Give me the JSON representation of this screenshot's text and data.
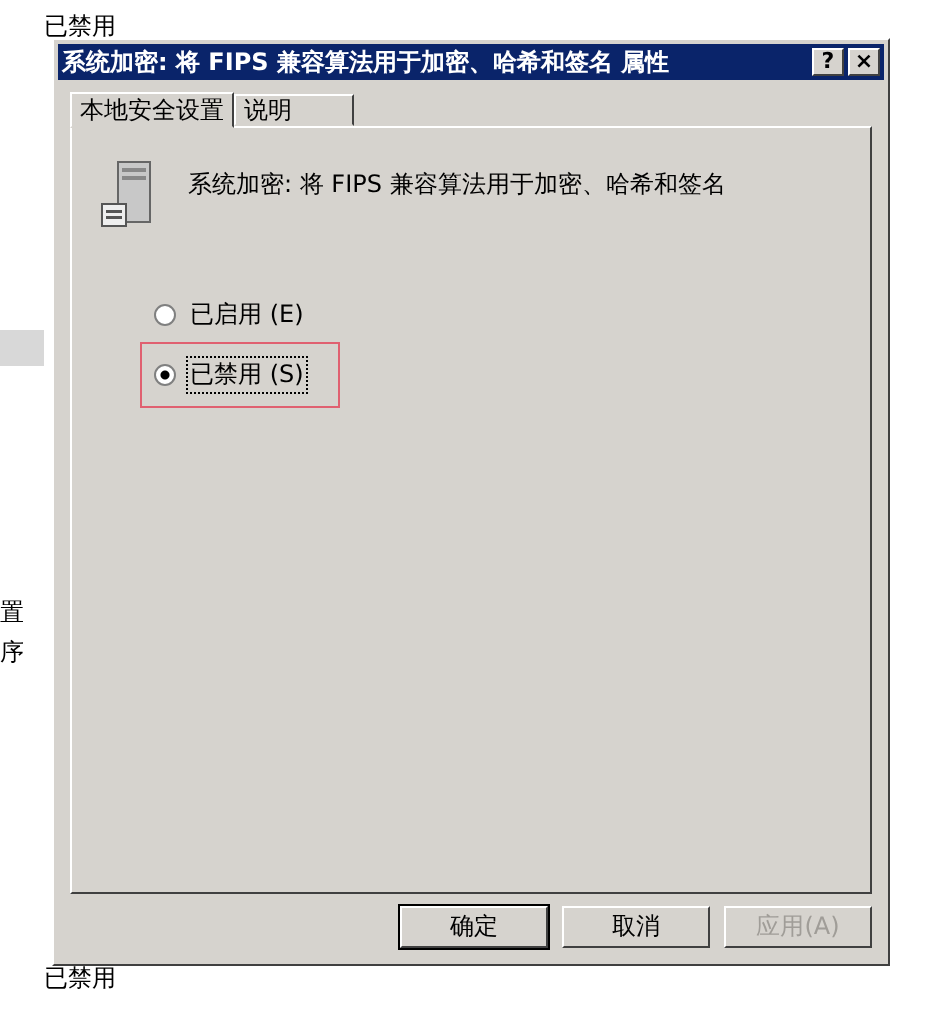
{
  "background_list": {
    "top_items": [
      "已禁用"
    ],
    "side_items": [
      "置",
      "序"
    ],
    "bottom_item": "已禁用"
  },
  "window": {
    "title": "系统加密: 将 FIPS 兼容算法用于加密、哈希和签名 属性",
    "help_button": "?",
    "close_button": "×"
  },
  "tabs": [
    {
      "label": "本地安全设置",
      "selected": true
    },
    {
      "label": "说明",
      "selected": false
    }
  ],
  "policy": {
    "name": "系统加密: 将 FIPS 兼容算法用于加密、哈希和签名"
  },
  "options": [
    {
      "label": "已启用 (E)",
      "selected": false,
      "highlighted": false
    },
    {
      "label": "已禁用 (S)",
      "selected": true,
      "highlighted": true
    }
  ],
  "buttons": [
    {
      "label": "确定",
      "disabled": false,
      "default": true
    },
    {
      "label": "取消",
      "disabled": false,
      "default": false
    },
    {
      "label": "应用(A)",
      "disabled": true,
      "default": false
    }
  ]
}
